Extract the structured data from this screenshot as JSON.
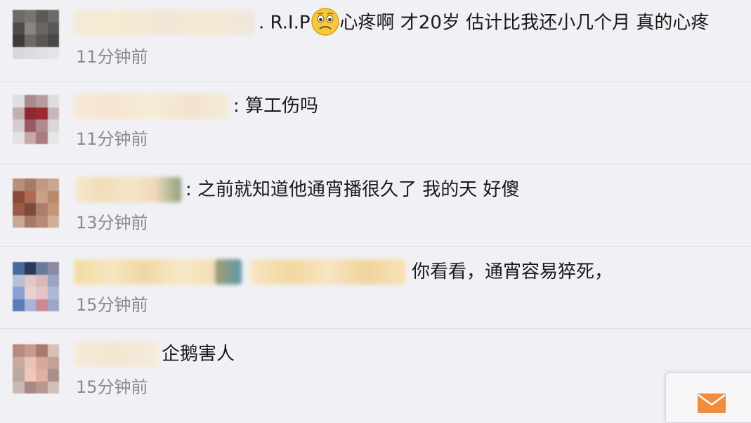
{
  "comments": [
    {
      "prefix": ". R.I.P",
      "emoji": "sad-face-emoji",
      "text": "心疼啊 才20岁 估计比我还小几个月 真的心疼",
      "time": "11分钟前"
    },
    {
      "text": ": 算工伤吗",
      "time": "11分钟前"
    },
    {
      "text": ": 之前就知道他通宵播很久了 我的天 好傻",
      "time": "13分钟前"
    },
    {
      "text": "你看看，通宵容易猝死，",
      "time": "15分钟前"
    },
    {
      "text": "企鹅害人",
      "time": "15分钟前"
    }
  ],
  "floating_button": {
    "icon": "mail-icon",
    "color": "#f08c3c"
  }
}
